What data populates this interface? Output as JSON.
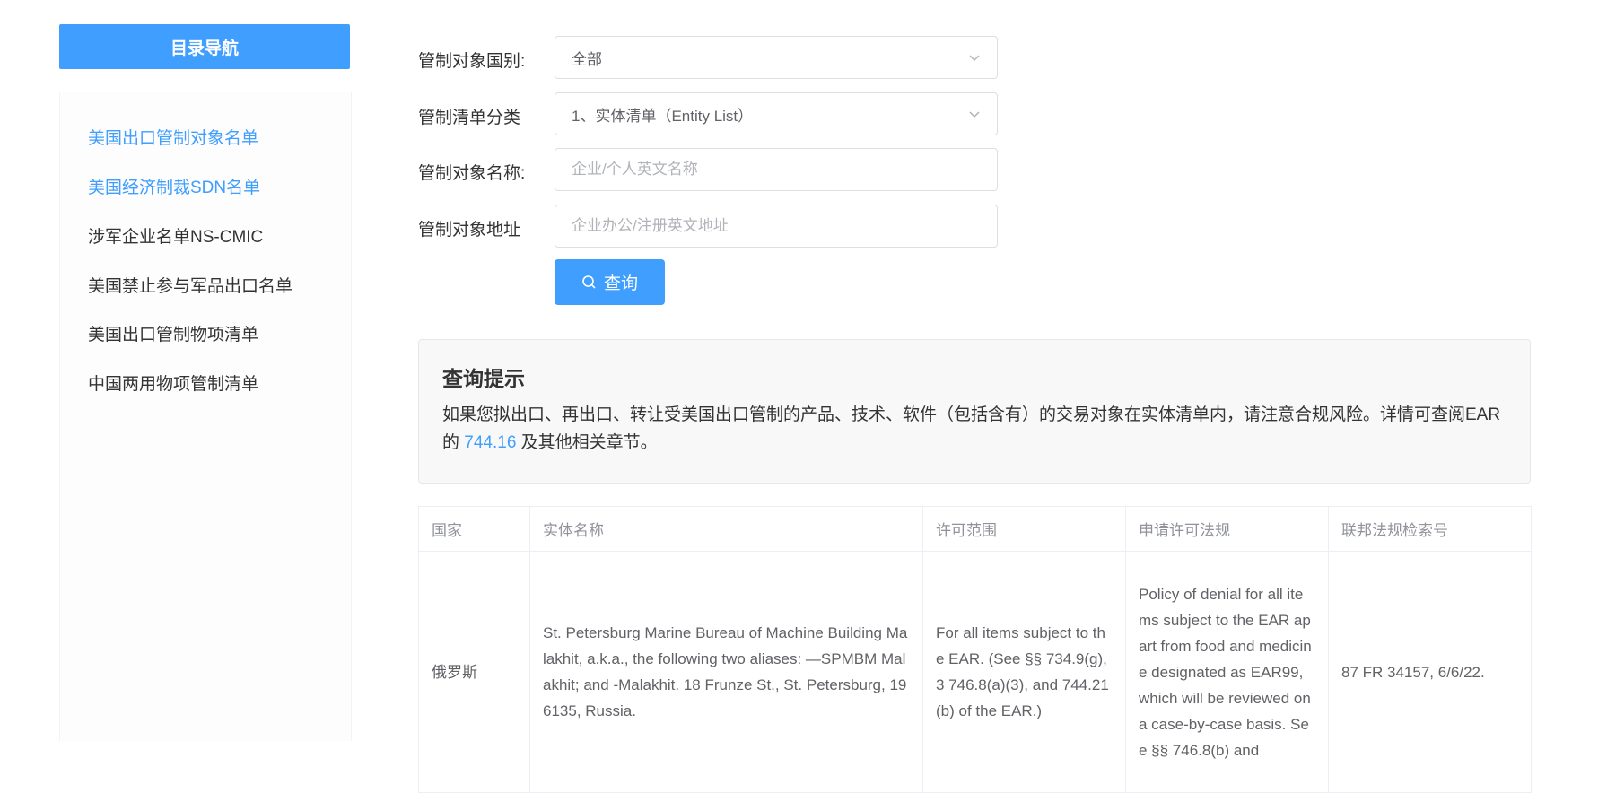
{
  "sidebar": {
    "title": "目录导航",
    "items": [
      {
        "label": "美国出口管制对象名单",
        "active": true
      },
      {
        "label": "美国经济制裁SDN名单",
        "active": true
      },
      {
        "label": "涉军企业名单NS-CMIC",
        "active": false
      },
      {
        "label": "美国禁止参与军品出口名单",
        "active": false
      },
      {
        "label": "美国出口管制物项清单",
        "active": false
      },
      {
        "label": "中国两用物项管制清单",
        "active": false
      }
    ]
  },
  "form": {
    "country_label": "管制对象国别:",
    "country_value": "全部",
    "category_label": "管制清单分类",
    "category_value": "1、实体清单（Entity List）",
    "name_label": "管制对象名称:",
    "name_placeholder": "企业/个人英文名称",
    "address_label": "管制对象地址",
    "address_placeholder": "企业办公/注册英文地址",
    "query_label": "查询"
  },
  "notice": {
    "title": "查询提示",
    "text_before": "如果您拟出口、再出口、转让受美国出口管制的产品、技术、软件（包括含有）的交易对象在实体清单内，请注意合规风险。详情可查阅EAR的 ",
    "link": "744.16",
    "text_after": " 及其他相关章节。"
  },
  "table": {
    "headers": [
      "国家",
      "实体名称",
      "许可范围",
      "申请许可法规",
      "联邦法规检索号"
    ],
    "rows": [
      {
        "country": "俄罗斯",
        "entity": "St. Petersburg Marine Bureau of Machine Building Malakhit, a.k.a., the following two aliases: —SPMBM Malakhit; and -Malakhit. 18 Frunze St., St. Petersburg, 196135, Russia.",
        "scope": "For all items subject to the EAR. (See §§ 734.9(g),3 746.8(a)(3), and 744.21(b) of the EAR.)",
        "policy": "Policy of denial for all items subject to the EAR apart from food and medicine designated as EAR99, which will be reviewed on a case-by-case basis. See §§ 746.8(b) and",
        "fr": "87 FR 34157, 6/6/22."
      }
    ]
  },
  "colors": {
    "accent": "#409eff"
  }
}
